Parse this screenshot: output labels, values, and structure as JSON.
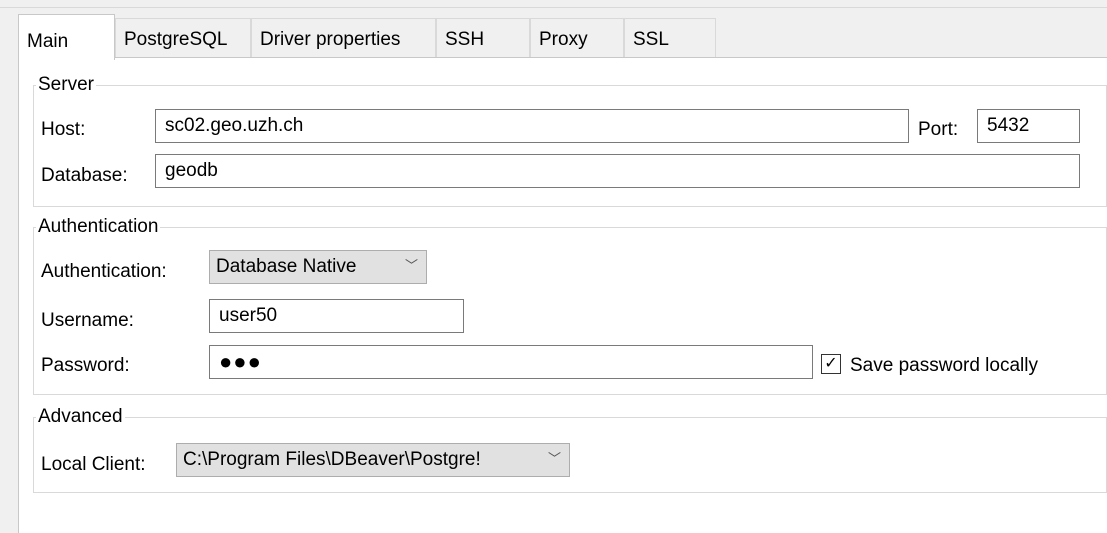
{
  "tabs": [
    {
      "label": "Main",
      "active": true
    },
    {
      "label": "PostgreSQL"
    },
    {
      "label": "Driver properties"
    },
    {
      "label": "SSH"
    },
    {
      "label": "Proxy"
    },
    {
      "label": "SSL"
    }
  ],
  "server": {
    "legend": "Server",
    "host_label": "Host:",
    "host_value": "sc02.geo.uzh.ch",
    "port_label": "Port:",
    "port_value": "5432",
    "database_label": "Database:",
    "database_value": "geodb"
  },
  "authentication": {
    "legend": "Authentication",
    "auth_label": "Authentication:",
    "auth_value": "Database Native",
    "username_label": "Username:",
    "username_value": "user50",
    "password_label": "Password:",
    "password_mask": "●●●",
    "save_password_label": "Save password locally",
    "save_password_checked": true,
    "check_glyph": "✓"
  },
  "advanced": {
    "legend": "Advanced",
    "local_client_label": "Local Client:",
    "local_client_value": "C:\\Program Files\\DBeaver\\Postgre!"
  },
  "icons": {
    "chevron": "﹀"
  }
}
